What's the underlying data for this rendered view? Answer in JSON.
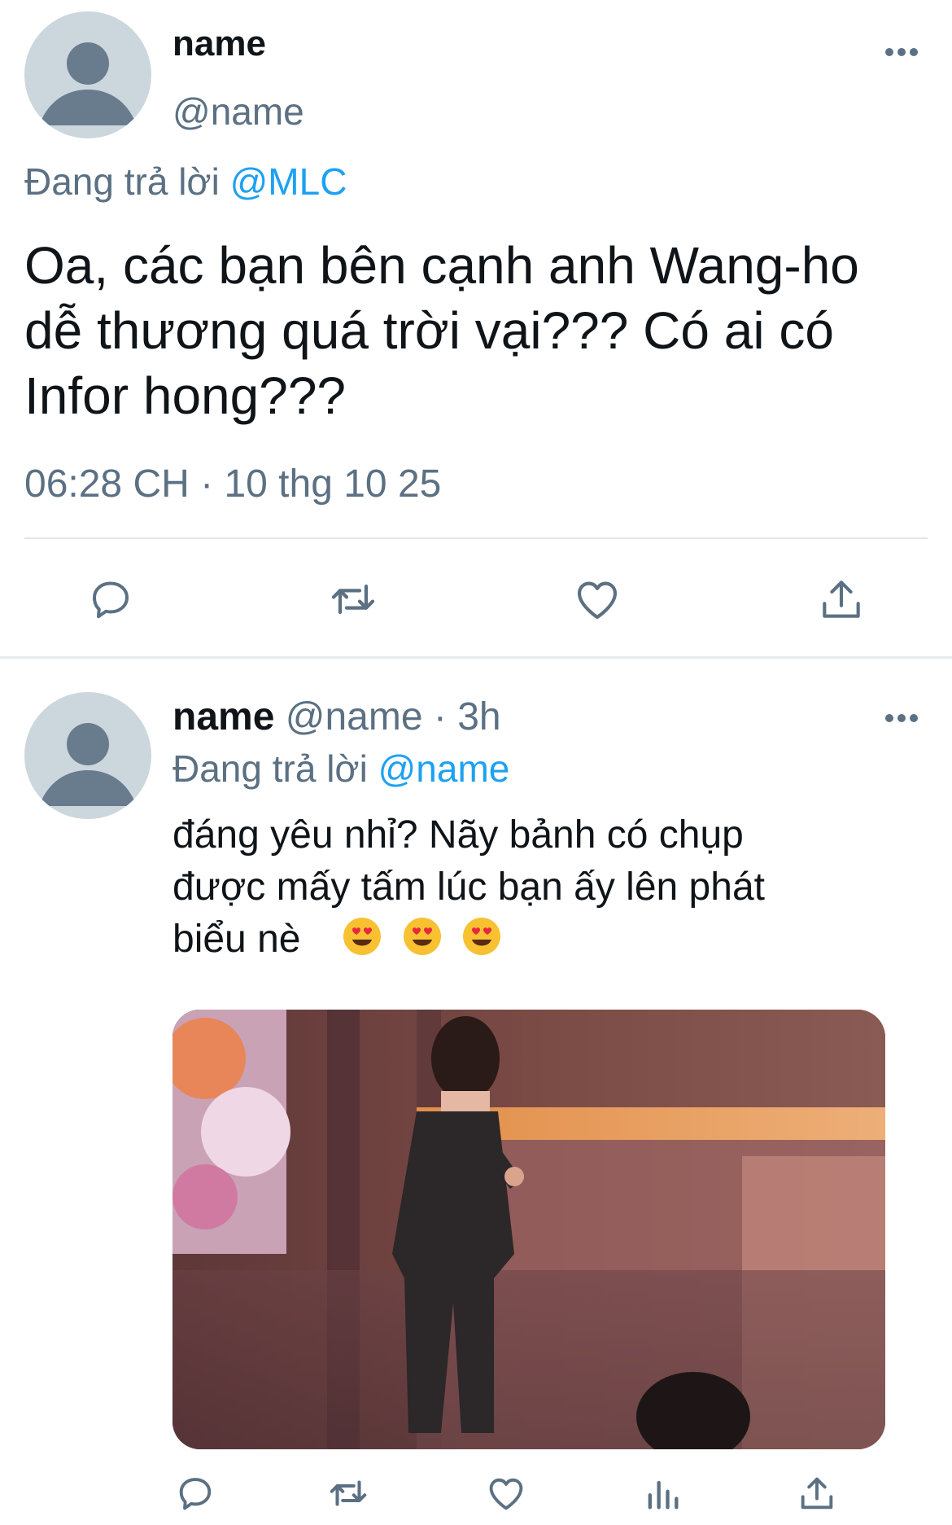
{
  "main_tweet": {
    "display_name": "name",
    "handle": "@name",
    "replying_prefix": "Đang trả lời",
    "replying_to": "@MLC",
    "text_lines": [
      "Oa, các bạn bên cạnh anh Wang-ho",
      "dễ thương quá trời vại??? Có ai có",
      "Infor hong???"
    ],
    "timestamp": "06:28 CH · 10 thg 10 25"
  },
  "reply_tweet": {
    "display_name": "name",
    "handle": "@name",
    "time": "· 3h",
    "replying_prefix": "Đang trả lời",
    "replying_to": "@name",
    "text_lines": [
      "đáng yêu nhỉ? Nãy bảnh có chụp",
      "được mấy tấm lúc bạn ấy lên phát",
      "biểu nè"
    ],
    "emojis": [
      "heart-eyes",
      "heart-eyes",
      "heart-eyes"
    ],
    "media": {
      "kind": "photo"
    }
  },
  "icons": {
    "reply": "reply-icon",
    "retweet": "retweet-icon",
    "like": "heart-icon",
    "share": "share-icon",
    "analytics": "analytics-icon",
    "more": "more-icon"
  },
  "colors": {
    "link": "#1da1f2",
    "secondary_text": "#5b7083",
    "avatar_bg": "#ccd6dd",
    "avatar_fg": "#687c8d",
    "divider": "#e1e8ed"
  }
}
